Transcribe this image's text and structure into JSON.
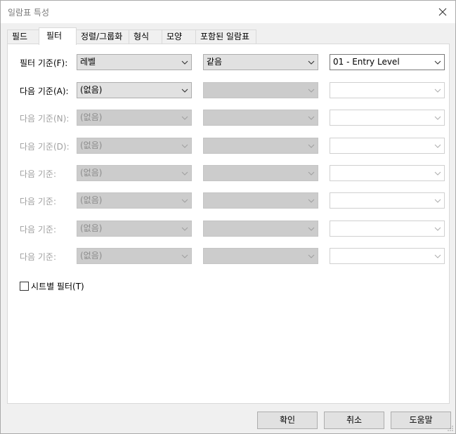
{
  "window": {
    "title": "일람표 특성"
  },
  "tabs": [
    {
      "label": "필드",
      "active": false
    },
    {
      "label": "필터",
      "active": true
    },
    {
      "label": "정렬/그룹화",
      "active": false
    },
    {
      "label": "형식",
      "active": false
    },
    {
      "label": "모양",
      "active": false
    },
    {
      "label": "포함된 일람표",
      "active": false
    }
  ],
  "filters": [
    {
      "label": "필터 기준(F):",
      "field": "레벨",
      "condition": "같음",
      "value": "01 - Entry Level",
      "enabled": true
    },
    {
      "label": "다음 기준(A):",
      "field": "(없음)",
      "condition": "",
      "value": "",
      "enabled": true
    },
    {
      "label": "다음 기준(N):",
      "field": "(없음)",
      "condition": "",
      "value": "",
      "enabled": false
    },
    {
      "label": "다음 기준(D):",
      "field": "(없음)",
      "condition": "",
      "value": "",
      "enabled": false
    },
    {
      "label": "다음 기준:",
      "field": "(없음)",
      "condition": "",
      "value": "",
      "enabled": false
    },
    {
      "label": "다음 기준:",
      "field": "(없음)",
      "condition": "",
      "value": "",
      "enabled": false
    },
    {
      "label": "다음 기준:",
      "field": "(없음)",
      "condition": "",
      "value": "",
      "enabled": false
    },
    {
      "label": "다음 기준:",
      "field": "(없음)",
      "condition": "",
      "value": "",
      "enabled": false
    }
  ],
  "sheet_filter": {
    "label": "시트별 필터(T)",
    "checked": false
  },
  "buttons": {
    "ok": "확인",
    "cancel": "취소",
    "help": "도움말"
  },
  "icons": {
    "close": "close-icon",
    "dropdown": "chevron-down-icon",
    "grip": "resize-grip-icon"
  }
}
